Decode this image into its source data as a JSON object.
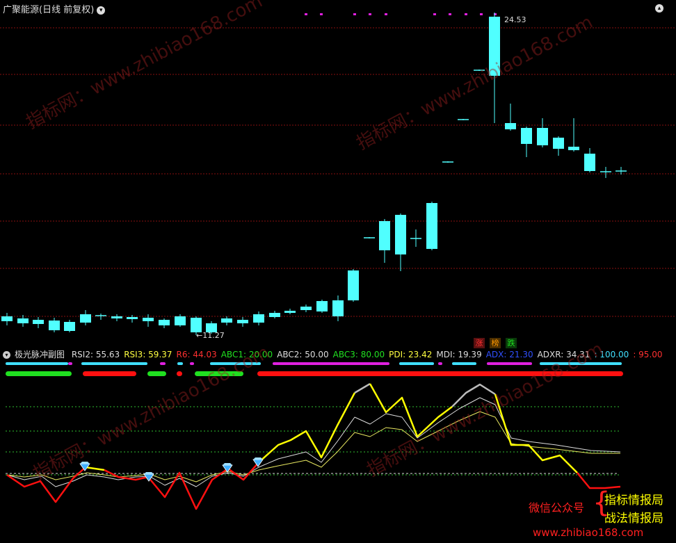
{
  "header": {
    "title": "广聚能源(日线 前复权)"
  },
  "price_chart": {
    "high_label": "24.53",
    "low_label": "11.27"
  },
  "tags": [
    {
      "label": "涨",
      "color": "#ff3030",
      "bg": "#5a1010"
    },
    {
      "label": "榜",
      "color": "#ff9900",
      "bg": "#4a2e00"
    },
    {
      "label": "跌",
      "color": "#20e020",
      "bg": "#0a3a0a"
    }
  ],
  "indicator": {
    "name": "极光脉冲副图",
    "values": [
      {
        "text": "RSI2: 55.63",
        "color": "#dddddd"
      },
      {
        "text": "RSI3: 59.37",
        "color": "#ffff40"
      },
      {
        "text": "R6: 44.03",
        "color": "#ff3030"
      },
      {
        "text": "ABC1: 20.00",
        "color": "#20e020"
      },
      {
        "text": "ABC2: 50.00",
        "color": "#dddddd"
      },
      {
        "text": "ABC3: 80.00",
        "color": "#20e020"
      },
      {
        "text": "PDI: 23.42",
        "color": "#ffff40"
      },
      {
        "text": "MDI: 19.39",
        "color": "#dddddd"
      },
      {
        "text": "ADX: 21.30",
        "color": "#3050ff"
      },
      {
        "text": "ADXR: 34.31",
        "color": "#dddddd"
      },
      {
        "text": ": 100.00",
        "color": "#40e0ff"
      },
      {
        "text": ": 95.00",
        "color": "#ff3030"
      }
    ]
  },
  "watermark": "指标网：www.zhibiao168.com",
  "brand": {
    "wechat": "微信公众号",
    "line1": "指标情报局",
    "line2": "战法情报局",
    "site": "www.zhibiao168.com"
  },
  "colors": {
    "up": "#ff3030",
    "down": "#50ffff",
    "grid": "#8a1010",
    "magenta": "#e020e0"
  }
}
